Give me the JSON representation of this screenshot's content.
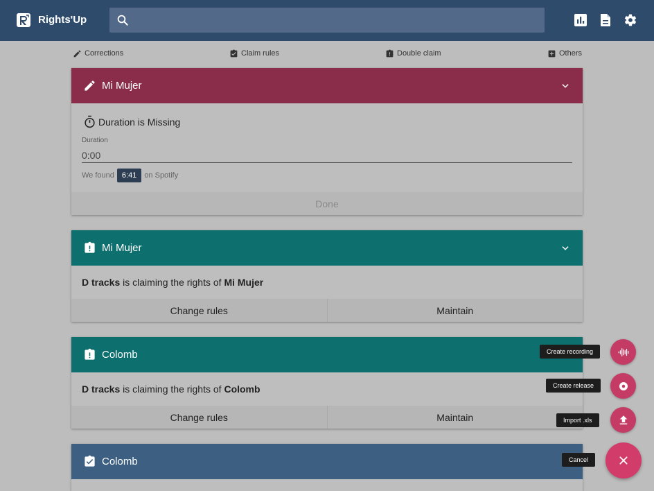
{
  "app": {
    "title": "Rights'Up"
  },
  "search": {
    "placeholder": ""
  },
  "topbar_icons": [
    "bar-chart-icon",
    "document-icon",
    "gear-icon"
  ],
  "categories": [
    {
      "label": "Corrections",
      "icon": "pencil-icon"
    },
    {
      "label": "Claim rules",
      "icon": "clipboard-check-icon"
    },
    {
      "label": "Double claim",
      "icon": "clipboard-alert-icon"
    },
    {
      "label": "Others",
      "icon": "plus-box-icon"
    }
  ],
  "cards": [
    {
      "title": "Mi Mujer",
      "color": "#8a2d4a",
      "issue": "Duration is Missing",
      "field_label": "Duration",
      "field_value": "0:00",
      "found_prefix": "We found",
      "found_value": "6:41",
      "found_suffix": "on Spotify",
      "action": "Done"
    },
    {
      "title": "Mi Mujer",
      "color": "#0e6f6f",
      "claimer": "D tracks",
      "claim_mid": "is claiming the rights of",
      "claimed": "Mi Mujer",
      "actions": [
        "Change rules",
        "Maintain"
      ]
    },
    {
      "title": "Colomb",
      "color": "#0e6f6f",
      "claimer": "D tracks",
      "claim_mid": "is claiming the rights of",
      "claimed": "Colomb",
      "actions": [
        "Change rules",
        "Maintain"
      ]
    },
    {
      "title": "Colomb",
      "color": "#3d6082"
    }
  ],
  "fab_menu": {
    "items": [
      {
        "label": "Create recording",
        "icon": "waveform-icon"
      },
      {
        "label": "Create release",
        "icon": "disc-icon"
      },
      {
        "label": "Import .xls",
        "icon": "upload-icon"
      }
    ],
    "cancel_label": "Cancel",
    "accent": "#d23c6a"
  }
}
